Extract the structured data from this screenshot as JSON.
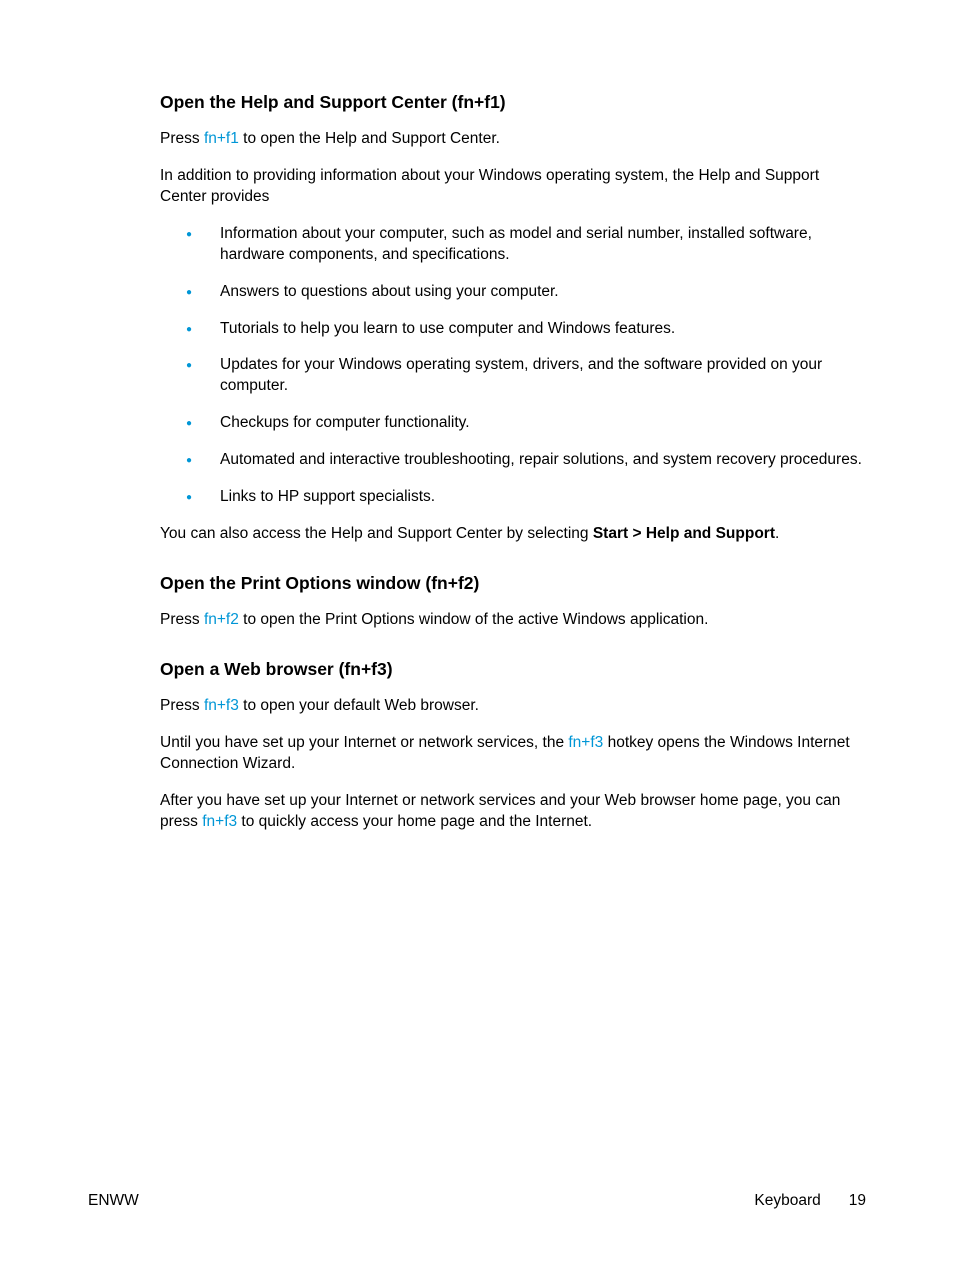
{
  "sections": {
    "s1": {
      "heading": "Open the Help and Support Center (fn+f1)",
      "p1_a": "Press ",
      "p1_key": "fn+f1",
      "p1_b": " to open the Help and Support Center.",
      "p2": "In addition to providing information about your Windows operating system, the Help and Support Center provides",
      "bullets": [
        "Information about your computer, such as model and serial number, installed software, hardware components, and specifications.",
        "Answers to questions about using your computer.",
        "Tutorials to help you learn to use computer and Windows features.",
        "Updates for your Windows operating system, drivers, and the software provided on your computer.",
        "Checkups for computer functionality.",
        "Automated and interactive troubleshooting, repair solutions, and system recovery procedures.",
        "Links to HP support specialists."
      ],
      "p3_a": "You can also access the Help and Support Center by selecting ",
      "p3_bold": "Start > Help and Support",
      "p3_b": "."
    },
    "s2": {
      "heading": "Open the Print Options window (fn+f2)",
      "p1_a": "Press ",
      "p1_key": "fn+f2",
      "p1_b": " to open the Print Options window of the active Windows application."
    },
    "s3": {
      "heading": "Open a Web browser (fn+f3)",
      "p1_a": "Press ",
      "p1_key": "fn+f3",
      "p1_b": " to open your default Web browser.",
      "p2_a": "Until you have set up your Internet or network services, the ",
      "p2_key": "fn+f3",
      "p2_b": " hotkey opens the Windows Internet Connection Wizard.",
      "p3_a": "After you have set up your Internet or network services and your Web browser home page, you can press ",
      "p3_key": "fn+f3",
      "p3_b": " to quickly access your home page and the Internet."
    }
  },
  "footer": {
    "left": "ENWW",
    "section": "Keyboard",
    "page": "19"
  }
}
